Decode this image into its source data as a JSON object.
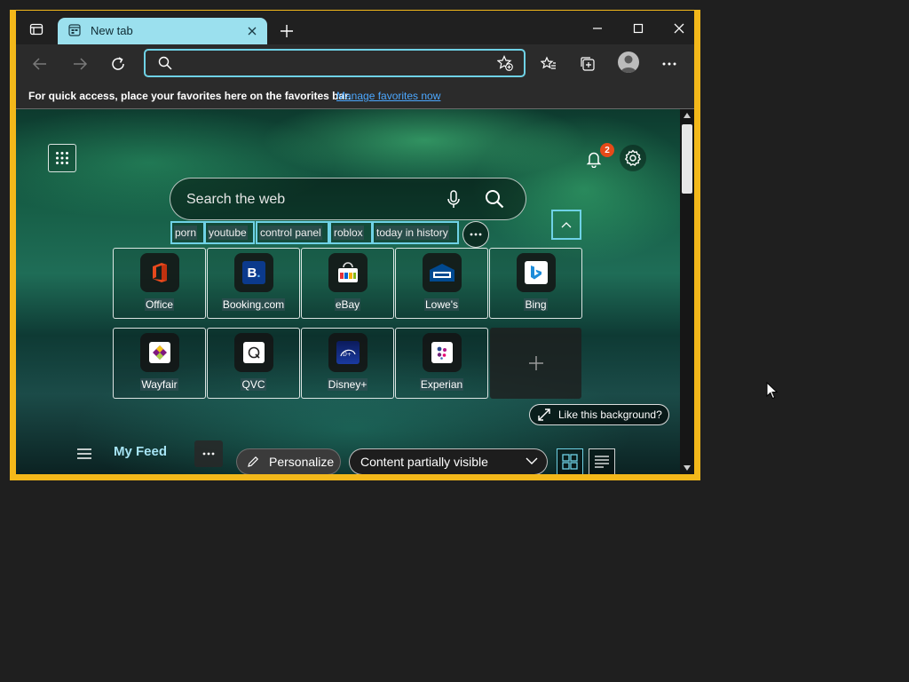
{
  "browser": {
    "tab": {
      "title": "New tab"
    },
    "address_bar": {
      "value": "",
      "placeholder": ""
    },
    "favorites_bar": {
      "message": "For quick access, place your favorites here on the favorites bar.",
      "link": "Manage favorites now"
    },
    "accent_color": "#6fd2e6",
    "window_border_color": "#f3b81a"
  },
  "new_tab_page": {
    "notifications_count": "2",
    "search": {
      "placeholder": "Search the web"
    },
    "recent_searches": [
      "porn",
      "youtube",
      "control panel",
      "roblox",
      "today in history"
    ],
    "quick_links": [
      {
        "label": "Office",
        "icon": "office-icon"
      },
      {
        "label": "Booking.com",
        "icon": "booking-icon"
      },
      {
        "label": "eBay",
        "icon": "ebay-icon"
      },
      {
        "label": "Lowe's",
        "icon": "lowes-icon"
      },
      {
        "label": "Bing",
        "icon": "bing-icon"
      },
      {
        "label": "Wayfair",
        "icon": "wayfair-icon"
      },
      {
        "label": "QVC",
        "icon": "qvc-icon"
      },
      {
        "label": "Disney+",
        "icon": "disney-plus-icon"
      },
      {
        "label": "Experian",
        "icon": "experian-icon"
      }
    ],
    "background_prompt": "Like this background?",
    "feed": {
      "title": "My Feed",
      "personalize_label": "Personalize",
      "visibility_option": "Content partially visible"
    }
  }
}
